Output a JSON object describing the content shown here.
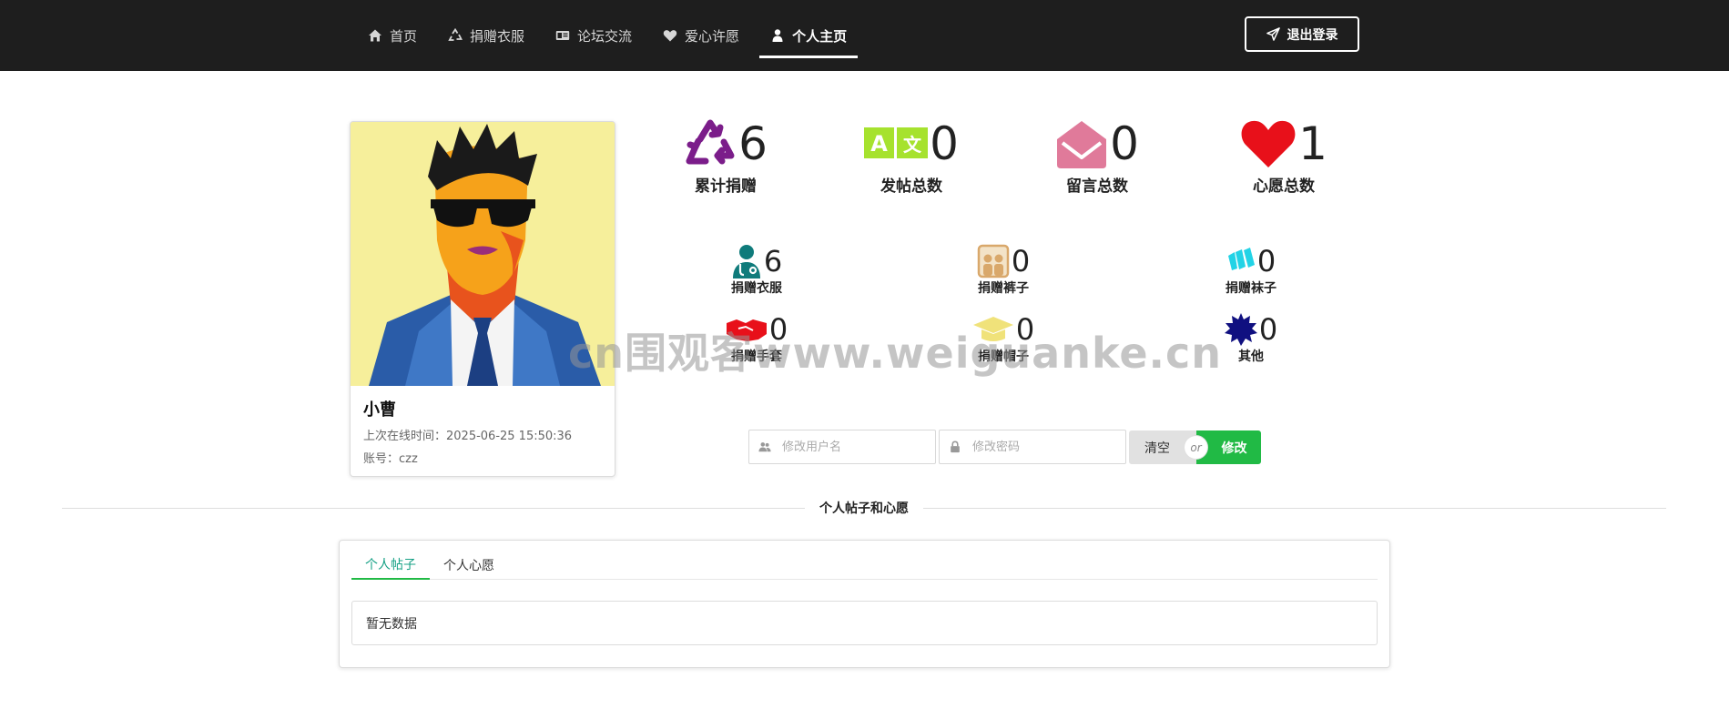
{
  "nav": {
    "items": [
      {
        "label": "首页",
        "icon": "home-icon"
      },
      {
        "label": "捐赠衣服",
        "icon": "recycle-icon"
      },
      {
        "label": "论坛交流",
        "icon": "id-card-icon"
      },
      {
        "label": "爱心许愿",
        "icon": "heart-icon"
      },
      {
        "label": "个人主页",
        "icon": "user-icon",
        "active": true
      }
    ],
    "logout_label": "退出登录"
  },
  "profile": {
    "name": "小曹",
    "last_online": "上次在线时间：2025-06-25 15:50:36",
    "account": "账号：czz"
  },
  "stats_main": [
    {
      "value": "6",
      "label": "累计捐赠",
      "icon": "recycle-icon",
      "color": "#7b1d8a"
    },
    {
      "value": "0",
      "label": "发帖总数",
      "icon": "translate-icon",
      "color": "#a6e22e"
    },
    {
      "value": "0",
      "label": "留言总数",
      "icon": "envelope-open-icon",
      "color": "#e07a9a"
    },
    {
      "value": "1",
      "label": "心愿总数",
      "icon": "heart-icon",
      "color": "#e8101a"
    }
  ],
  "stats_detail": [
    {
      "value": "6",
      "label": "捐赠衣服",
      "icon": "doctor-icon",
      "color": "#0f7b7b"
    },
    {
      "value": "0",
      "label": "捐赠裤子",
      "icon": "pants-icon",
      "color": "#d9a86b"
    },
    {
      "value": "0",
      "label": "捐赠袜子",
      "icon": "socks-icon",
      "color": "#22d3e6"
    },
    {
      "value": "0",
      "label": "捐赠手套",
      "icon": "handshake-icon",
      "color": "#e8101a"
    },
    {
      "value": "0",
      "label": "捐赠帽子",
      "icon": "graduation-cap-icon",
      "color": "#f0e27a"
    },
    {
      "value": "0",
      "label": "其他",
      "icon": "starburst-icon",
      "color": "#101080"
    }
  ],
  "form": {
    "username_placeholder": "修改用户名",
    "password_placeholder": "修改密码",
    "clear_label": "清空",
    "or_label": "or",
    "modify_label": "修改"
  },
  "divider_label": "个人帖子和心愿",
  "tabs": [
    {
      "label": "个人帖子",
      "active": true
    },
    {
      "label": "个人心愿"
    }
  ],
  "empty_text": "暂无数据",
  "watermark": "cn围观客www.weiguanke.cn",
  "colors": {
    "nav_bg": "#1e1e1e",
    "accent_green": "#21ba45",
    "tab_active": "#16a085"
  }
}
